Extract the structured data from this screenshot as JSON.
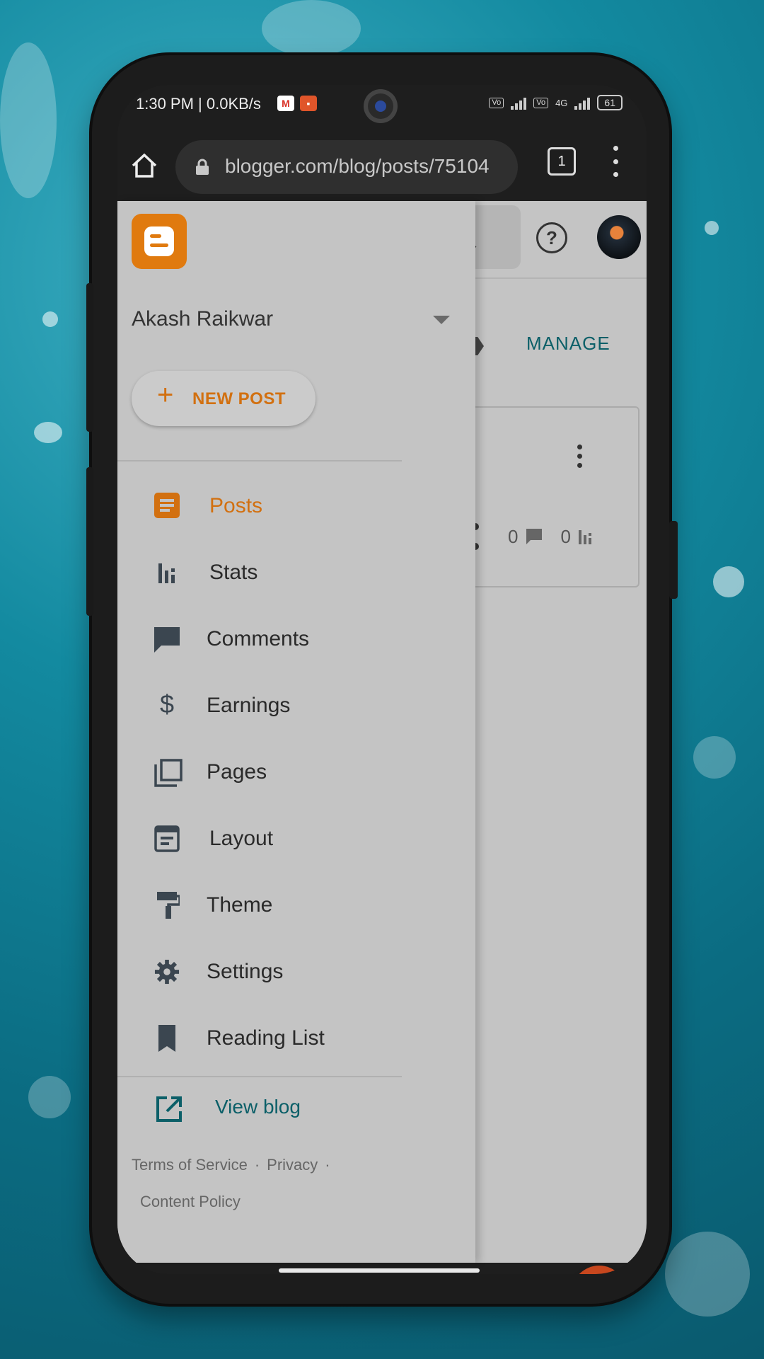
{
  "status_bar": {
    "time": "1:30 PM | 0.0KB/s",
    "battery": "61",
    "network_label": "4G"
  },
  "browser": {
    "url": "blogger.com/blog/posts/75104",
    "tab_count": "1"
  },
  "header": {
    "manage_label": "MANAGE"
  },
  "post_card": {
    "comment_count": "0",
    "view_count": "0"
  },
  "drawer": {
    "account_name": "Akash Raikwar",
    "new_post_label": "NEW POST",
    "nav_items": [
      {
        "label": "Posts",
        "icon": "posts-icon",
        "active": true
      },
      {
        "label": "Stats",
        "icon": "stats-icon"
      },
      {
        "label": "Comments",
        "icon": "comments-icon"
      },
      {
        "label": "Earnings",
        "icon": "earnings-icon"
      },
      {
        "label": "Pages",
        "icon": "pages-icon"
      },
      {
        "label": "Layout",
        "icon": "layout-icon"
      },
      {
        "label": "Theme",
        "icon": "theme-icon"
      },
      {
        "label": "Settings",
        "icon": "settings-icon"
      },
      {
        "label": "Reading List",
        "icon": "bookmark-icon"
      }
    ],
    "view_blog_label": "View blog",
    "footer": {
      "terms": "Terms of Service",
      "privacy": "Privacy",
      "content_policy": "Content Policy",
      "separator": "·"
    }
  },
  "colors": {
    "accent_orange": "#d27010",
    "link_teal": "#0b5f68",
    "fab_red": "#c7471e",
    "drawer_bg": "#c4c4c4"
  }
}
